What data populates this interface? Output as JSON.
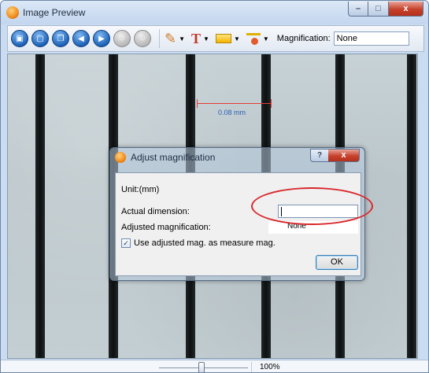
{
  "window": {
    "title": "Image Preview",
    "buttons": {
      "minimize": "–",
      "maximize": "□",
      "close": "x"
    }
  },
  "toolbar": {
    "buttons": [
      {
        "icon": "save-icon",
        "style": "blue"
      },
      {
        "icon": "open-icon",
        "style": "blue"
      },
      {
        "icon": "copy-icon",
        "style": "blue"
      },
      {
        "icon": "back-icon",
        "style": "blue"
      },
      {
        "icon": "forward-icon",
        "style": "blue"
      },
      {
        "icon": "rotate-left-icon",
        "style": "gray"
      },
      {
        "icon": "rotate-right-icon",
        "style": "gray"
      }
    ],
    "tools": [
      "pencil-icon",
      "text-icon",
      "color-fill-icon",
      "ruler-icon"
    ],
    "magnification_label": "Magnification:",
    "magnification_value": "None"
  },
  "image": {
    "measurement_label": "0.08 mm",
    "measurement_color": "#e43b35"
  },
  "dialog": {
    "title": "Adjust magnification",
    "help_label": "?",
    "close_label": "x",
    "unit_label": "Unit:(mm)",
    "actual_dimension_label": "Actual dimension:",
    "actual_dimension_value": "",
    "adjusted_magnification_label": "Adjusted magnification:",
    "adjusted_magnification_value": "None",
    "use_adjusted_label": "Use adjusted mag. as measure mag.",
    "use_adjusted_checked": true,
    "ok_label": "OK"
  },
  "statusbar": {
    "zoom_level": 0.45,
    "zoom_text": "100%"
  }
}
